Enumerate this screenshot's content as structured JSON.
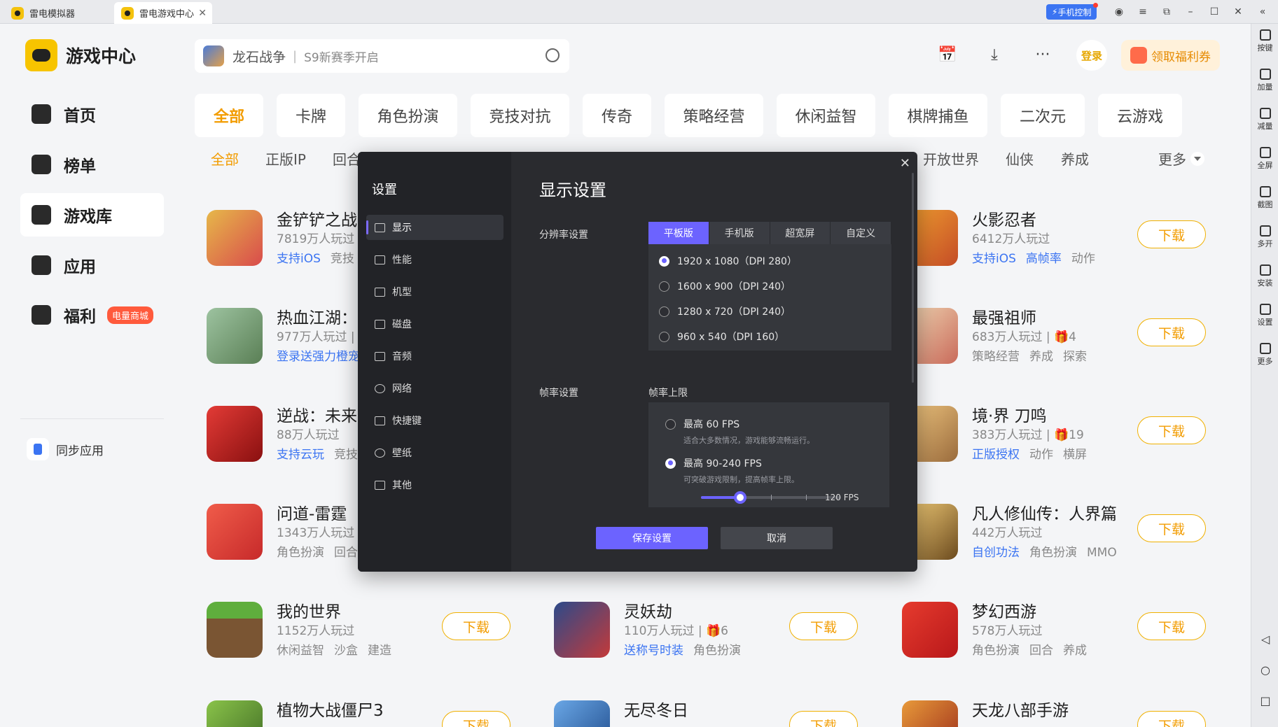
{
  "titlebar": {
    "tabs": [
      {
        "label": "雷电模拟器"
      },
      {
        "label": "雷电游戏中心"
      }
    ],
    "phone_control": "手机控制"
  },
  "rightbar": {
    "items": [
      "按键",
      "加量",
      "减量",
      "全屏",
      "截图",
      "多开",
      "安装",
      "设置",
      "更多"
    ]
  },
  "brand": {
    "title": "游戏中心"
  },
  "sidebar": {
    "items": [
      {
        "label": "首页"
      },
      {
        "label": "榜单"
      },
      {
        "label": "游戏库"
      },
      {
        "label": "应用"
      },
      {
        "label": "福利",
        "badge": "电量商城"
      }
    ],
    "sync": "同步应用"
  },
  "search": {
    "game": "龙石战争",
    "divider": "|",
    "hint": "S9新赛季开启"
  },
  "header": {
    "login": "登录",
    "coupon": "领取福利券"
  },
  "categories": [
    "全部",
    "卡牌",
    "角色扮演",
    "竞技对抗",
    "传奇",
    "策略经营",
    "休闲益智",
    "棋牌捕鱼",
    "二次元",
    "云游戏"
  ],
  "subcategories": [
    "全部",
    "正版IP",
    "回合",
    "开放世界",
    "仙侠",
    "养成"
  ],
  "more_label": "更多",
  "games": [
    {
      "name": "金铲铲之战",
      "plays": "7819万人玩过",
      "tags": [
        {
          "text": "支持iOS",
          "hl": true
        },
        {
          "text": "竞技",
          "hl": false
        }
      ]
    },
    {
      "name": "火影忍者",
      "plays": "6412万人玩过",
      "tags": [
        {
          "text": "支持iOS",
          "hl": true
        },
        {
          "text": "高帧率",
          "hl": true
        },
        {
          "text": "动作",
          "hl": false
        }
      ],
      "dl": "下载"
    },
    {
      "name": "热血江湖：归",
      "plays": "977万人玩过 |",
      "tags": [
        {
          "text": "登录送强力橙宠",
          "hl": true
        }
      ]
    },
    {
      "name": "最强祖师",
      "plays": "683万人玩过 | 🎁4",
      "tags": [
        {
          "text": "策略经营",
          "hl": false
        },
        {
          "text": "养成",
          "hl": false
        },
        {
          "text": "探索",
          "hl": false
        }
      ],
      "dl": "下载"
    },
    {
      "name": "逆战：未来",
      "plays": "88万人玩过",
      "tags": [
        {
          "text": "支持云玩",
          "hl": true
        },
        {
          "text": "竞技",
          "hl": false
        }
      ]
    },
    {
      "name": "境·界 刀鸣",
      "plays": "383万人玩过 | 🎁19",
      "tags": [
        {
          "text": "正版授权",
          "hl": true
        },
        {
          "text": "动作",
          "hl": false
        },
        {
          "text": "横屏",
          "hl": false
        }
      ],
      "dl": "下载"
    },
    {
      "name": "问道-雷霆",
      "plays": "1343万人玩过",
      "tags": [
        {
          "text": "角色扮演",
          "hl": false
        },
        {
          "text": "回合",
          "hl": false
        }
      ]
    },
    {
      "name": "凡人修仙传：人界篇",
      "plays": "442万人玩过",
      "tags": [
        {
          "text": "自创功法",
          "hl": true
        },
        {
          "text": "角色扮演",
          "hl": false
        },
        {
          "text": "MMO",
          "hl": false
        }
      ],
      "dl": "下载"
    },
    {
      "name": "我的世界",
      "plays": "1152万人玩过",
      "tags": [
        {
          "text": "休闲益智",
          "hl": false
        },
        {
          "text": "沙盒",
          "hl": false
        },
        {
          "text": "建造",
          "hl": false
        }
      ],
      "dl": "下载"
    },
    {
      "name": "灵妖劫",
      "plays": "110万人玩过 | 🎁6",
      "tags": [
        {
          "text": "送称号时装",
          "hl": true
        },
        {
          "text": "角色扮演",
          "hl": false
        }
      ],
      "dl": "下载"
    },
    {
      "name": "梦幻西游",
      "plays": "578万人玩过",
      "tags": [
        {
          "text": "角色扮演",
          "hl": false
        },
        {
          "text": "回合",
          "hl": false
        },
        {
          "text": "养成",
          "hl": false
        }
      ],
      "dl": "下载"
    },
    {
      "name": "植物大战僵尸3",
      "plays": "",
      "tags": [],
      "dl": "下载"
    },
    {
      "name": "无尽冬日",
      "plays": "",
      "tags": [],
      "dl": "下载"
    },
    {
      "name": "天龙八部手游",
      "plays": "",
      "tags": [],
      "dl": "下载"
    }
  ],
  "modal": {
    "title": "设置",
    "menu": [
      "显示",
      "性能",
      "机型",
      "磁盘",
      "音频",
      "网络",
      "快捷键",
      "壁纸",
      "其他"
    ],
    "heading": "显示设置",
    "resolution_label": "分辨率设置",
    "segments": [
      "平板版",
      "手机版",
      "超宽屏",
      "自定义"
    ],
    "resolutions": [
      "1920 x 1080（DPI 280）",
      "1600 x 900（DPI 240）",
      "1280 x 720（DPI 240）",
      "960 x 540（DPI 160）"
    ],
    "fps_label": "帧率设置",
    "fps_limit_label": "帧率上限",
    "fps_options": [
      {
        "title": "最高 60 FPS",
        "desc": "适合大多数情况，游戏能够流畅运行。"
      },
      {
        "title": "最高 90-240 FPS",
        "desc": "可突破游戏限制，提高帧率上限。"
      }
    ],
    "fps_value": "120 FPS",
    "fps_slider_fraction": 0.28,
    "save": "保存设置",
    "cancel": "取消"
  }
}
